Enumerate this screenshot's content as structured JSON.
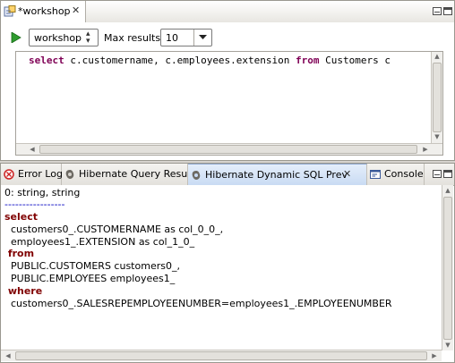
{
  "editor": {
    "tab_title": "*workshop",
    "run_icon": "run-icon",
    "config_value": "workshop",
    "max_results_label": "Max results:",
    "max_results_value": "10",
    "query_text_keyword1": "select",
    "query_text_mid": " c.customername, c.employees.extension ",
    "query_text_keyword2": "from",
    "query_text_end": " Customers c"
  },
  "bottom": {
    "tabs": [
      {
        "label": "Error Log",
        "icon": "error-log-icon",
        "active": false
      },
      {
        "label": "Hibernate Query Result",
        "icon": "hibernate-icon",
        "active": false
      },
      {
        "label": "Hibernate Dynamic SQL Prev",
        "icon": "hibernate-icon",
        "active": true
      },
      {
        "label": "Console",
        "icon": "console-icon",
        "active": false
      }
    ],
    "output": {
      "line0": "0: string, string",
      "separator": "-----------------",
      "kw_select": "select",
      "line_sel1": "  customers0_.CUSTOMERNAME as col_0_0_,",
      "line_sel2": "  employees1_.EXTENSION as col_1_0_",
      "kw_from": " from",
      "line_from1": "  PUBLIC.CUSTOMERS customers0_,",
      "line_from2": "  PUBLIC.EMPLOYEES employees1_",
      "kw_where": " where",
      "line_where1": "  customers0_.SALESREPEMPLOYEENUMBER=employees1_.EMPLOYEENUMBER"
    }
  },
  "colors": {
    "sql_keyword": "#7f0055",
    "result_keyword": "#800000",
    "separator": "#0000c0",
    "active_tab": "#c9dbf3"
  }
}
